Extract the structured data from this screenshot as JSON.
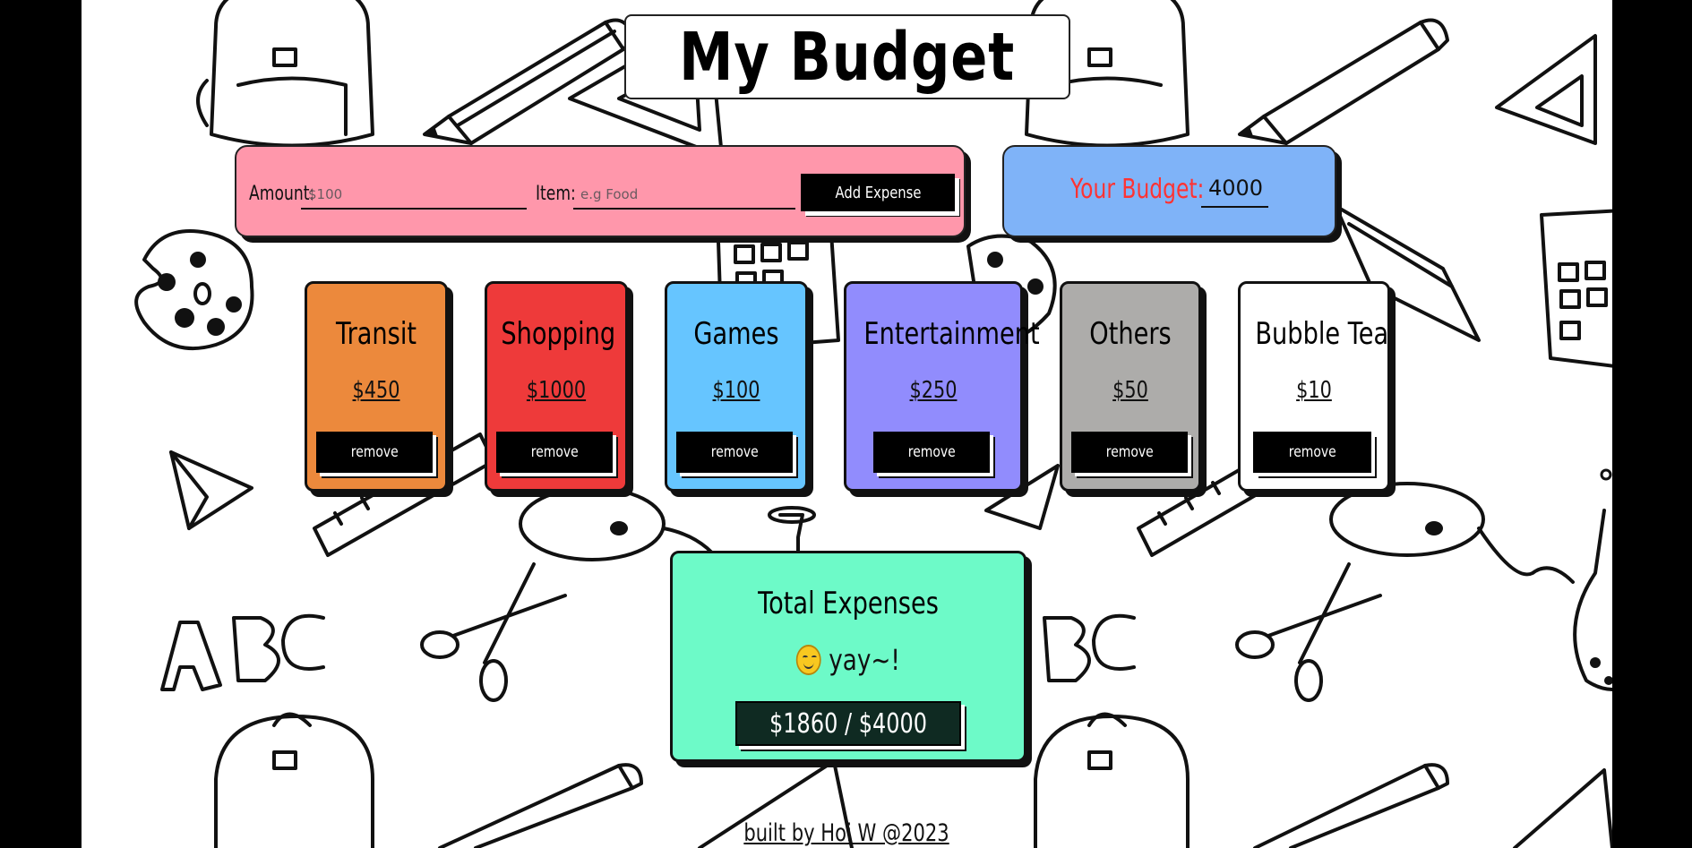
{
  "app": {
    "title": "My Budget"
  },
  "expense_form": {
    "amount_label": "Amount:",
    "amount_placeholder": "$100",
    "item_label": "Item:",
    "item_placeholder": "e.g Food",
    "add_button_label": "Add Expense"
  },
  "budget": {
    "label": "Your Budget:",
    "value": "4000"
  },
  "categories": [
    {
      "name": "Transit",
      "amount": "$450",
      "remove_label": "remove",
      "color": "#ec893c"
    },
    {
      "name": "Shopping",
      "amount": "$1000",
      "remove_label": "remove",
      "color": "#ee3a3a"
    },
    {
      "name": "Games",
      "amount": "$100",
      "remove_label": "remove",
      "color": "#66c5ff"
    },
    {
      "name": "Entertainment",
      "amount": "$250",
      "remove_label": "remove",
      "color": "#918cfd"
    },
    {
      "name": "Others",
      "amount": "$50",
      "remove_label": "remove",
      "color": "#adacaa"
    },
    {
      "name": "Bubble Tea",
      "amount": "$10",
      "remove_label": "remove",
      "color": "#ffffff"
    }
  ],
  "total": {
    "title": "Total Expenses",
    "status_text": "yay~!",
    "status_icon": "smiling-face-icon",
    "value": "$1860 / $4000"
  },
  "footer": {
    "text": "built by Hoi W @2023"
  }
}
